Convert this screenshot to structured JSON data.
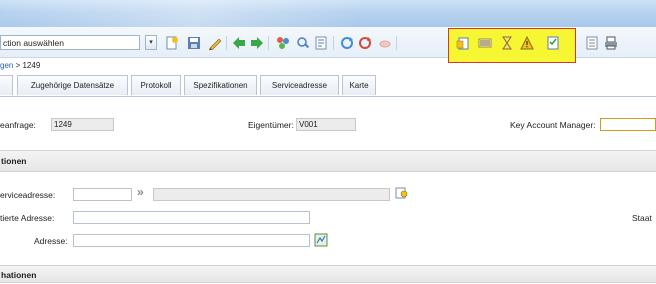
{
  "toolbar": {
    "action_select_value": "ction auswählen",
    "dropdown_glyph": "▾"
  },
  "breadcrumb": {
    "link": "gen",
    "separator": " > ",
    "current": "1249"
  },
  "tabs": [
    {
      "label": "Zugehörige Datensätze"
    },
    {
      "label": "Protokoll"
    },
    {
      "label": "Spezifikationen"
    },
    {
      "label": "Serviceadresse"
    },
    {
      "label": "Karte"
    }
  ],
  "form": {
    "anfrage_label": "eanfrage:",
    "anfrage_value": "1249",
    "owner_label": "Eigentümer:",
    "owner_value": "V001",
    "kam_label": "Key Account Manager:"
  },
  "sections": {
    "first_title": "tionen",
    "second_title": "hationen"
  },
  "address": {
    "serviceadresse_label": "erviceadresse:",
    "arrow": "»",
    "tierte_label": "tierte Adresse:",
    "adresse_label": "Adresse:",
    "staat_label": "Staat"
  },
  "colors": {
    "highlight": "#f6f632",
    "highlight_border": "#d3392b",
    "link": "#2a5db0"
  }
}
